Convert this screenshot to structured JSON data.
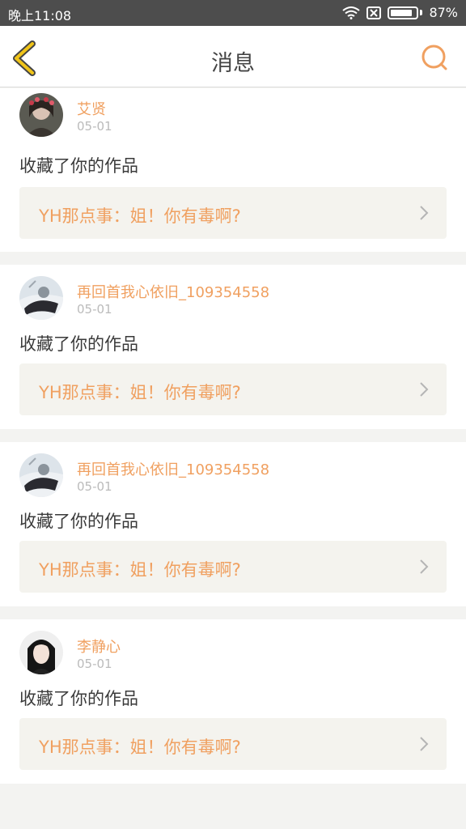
{
  "status": {
    "time": "晚上11:08",
    "battery": "87%",
    "battery_level": 0.87
  },
  "header": {
    "title": "消息"
  },
  "messages": [
    {
      "user": "艾贤",
      "date": "05-01",
      "action": "收藏了你的作品",
      "work": "YH那点事：姐！你有毒啊?"
    },
    {
      "user": "再回首我心依旧_109354558",
      "date": "05-01",
      "action": "收藏了你的作品",
      "work": "YH那点事：姐！你有毒啊?"
    },
    {
      "user": "再回首我心依旧_109354558",
      "date": "05-01",
      "action": "收藏了你的作品",
      "work": "YH那点事：姐！你有毒啊?"
    },
    {
      "user": "李静心",
      "date": "05-01",
      "action": "收藏了你的作品",
      "work": "YH那点事：姐！你有毒啊?"
    }
  ],
  "icons": {
    "back": "back-chevron-icon",
    "search": "search-icon",
    "work_link": "chevron-right-icon"
  },
  "colors": {
    "accent": "#f0a060",
    "back_icon": "#f0c419",
    "status_bar": "#4d4d4d"
  }
}
